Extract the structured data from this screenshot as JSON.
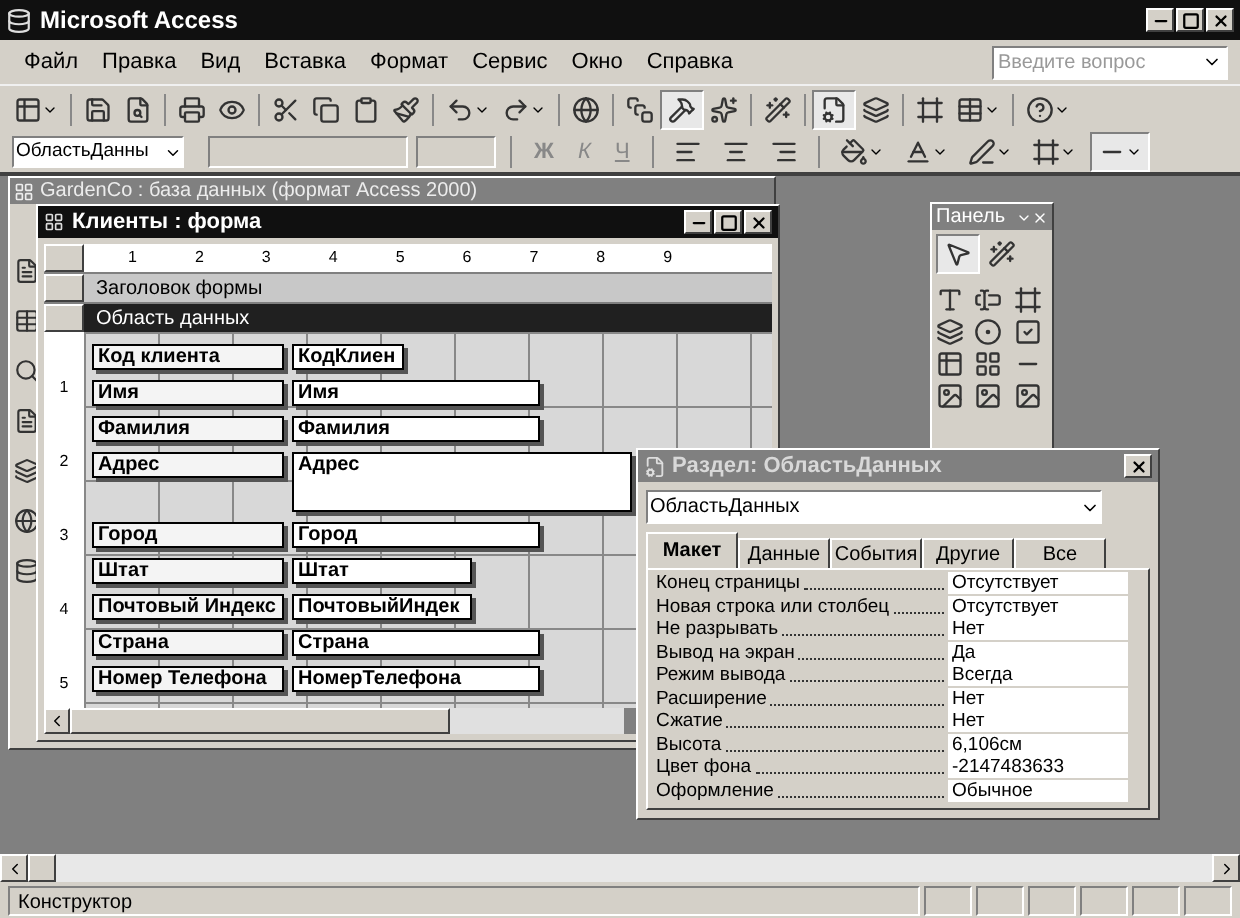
{
  "app": {
    "title": "Microsoft Access"
  },
  "menu": [
    {
      "label": "Файл"
    },
    {
      "label": "Правка"
    },
    {
      "label": "Вид"
    },
    {
      "label": "Вставка"
    },
    {
      "label": "Формат"
    },
    {
      "label": "Сервис"
    },
    {
      "label": "Окно"
    },
    {
      "label": "Справка"
    }
  ],
  "help_box": {
    "placeholder": "Введите вопрос"
  },
  "format_toolbar": {
    "object_box": "ОбластьДанны",
    "bold": "Ж",
    "italic": "К",
    "underline": "Ч"
  },
  "database_window": {
    "title": "GardenCo : база данных (формат Access 2000)"
  },
  "form_window": {
    "title": "Клиенты : форма",
    "ruler": [
      "1",
      "2",
      "3",
      "4",
      "5",
      "6",
      "7",
      "8",
      "9"
    ],
    "vruler": [
      "1",
      "2",
      "3",
      "4",
      "5"
    ],
    "sections": [
      {
        "label": "Заголовок формы",
        "selected": false
      },
      {
        "label": "Область данных",
        "selected": true
      }
    ],
    "fields": [
      {
        "label": "Код клиента",
        "control": "КодКлиен",
        "kind": "narrow"
      },
      {
        "label": "Имя",
        "control": "Имя",
        "kind": "medium"
      },
      {
        "label": "Фамилия",
        "control": "Фамилия",
        "kind": "medium"
      },
      {
        "label": "Адрес",
        "control": "Адрес",
        "kind": "tall"
      },
      {
        "label": "Город",
        "control": "Город",
        "kind": "medium"
      },
      {
        "label": "Штат",
        "control": "Штат",
        "kind": "short"
      },
      {
        "label": "Почтовый Индекс",
        "control": "ПочтовыйИндек",
        "kind": "short"
      },
      {
        "label": "Страна",
        "control": "Страна",
        "kind": "medium"
      },
      {
        "label": "Номер Телефона",
        "control": "НомерТелефона",
        "kind": "medium"
      }
    ]
  },
  "toolbox": {
    "title": "Панель"
  },
  "properties": {
    "title": "Раздел: ОбластьДанных",
    "object": "ОбластьДанных",
    "tabs": [
      {
        "label": "Макет",
        "selected": true
      },
      {
        "label": "Данные",
        "selected": false
      },
      {
        "label": "События",
        "selected": false
      },
      {
        "label": "Другие",
        "selected": false
      },
      {
        "label": "Все",
        "selected": false
      }
    ],
    "rows": [
      {
        "name": "Конец страницы",
        "value": "Отсутствует"
      },
      {
        "name": "Новая строка или столбец",
        "value": "Отсутствует"
      },
      {
        "name": "Не разрывать",
        "value": "Нет"
      },
      {
        "name": "Вывод на экран",
        "value": "Да"
      },
      {
        "name": "Режим вывода",
        "value": "Всегда"
      },
      {
        "name": "Расширение",
        "value": "Нет"
      },
      {
        "name": "Сжатие",
        "value": "Нет"
      },
      {
        "name": "Высота",
        "value": "6,106см"
      },
      {
        "name": "Цвет фона",
        "value": "-2147483633"
      },
      {
        "name": "Оформление",
        "value": "Обычное"
      }
    ]
  },
  "status_bar": {
    "text": "Конструктор"
  }
}
